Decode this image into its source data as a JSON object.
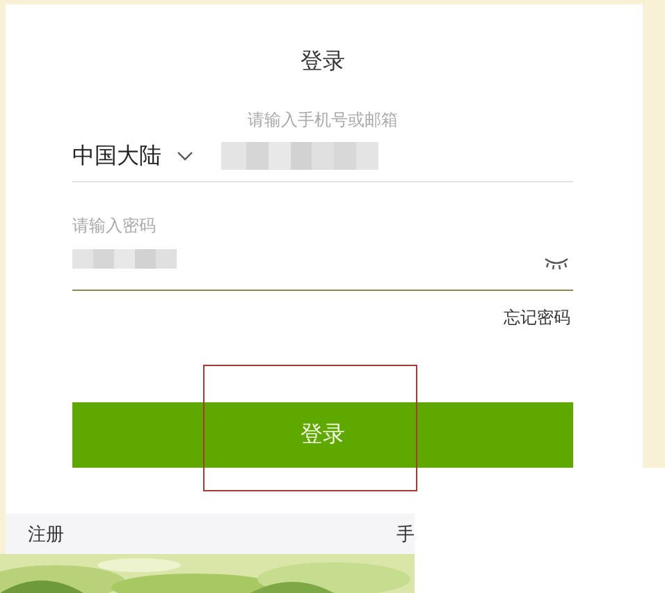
{
  "title": "登录",
  "phone": {
    "label": "请输入手机号或邮箱",
    "region": "中国大陆",
    "redacted": true
  },
  "password": {
    "label": "请输入密码",
    "redacted": true,
    "visible": false
  },
  "forgot_link": "忘记密码",
  "submit_button": "登录",
  "footer_links": [
    "注册",
    "手"
  ]
}
